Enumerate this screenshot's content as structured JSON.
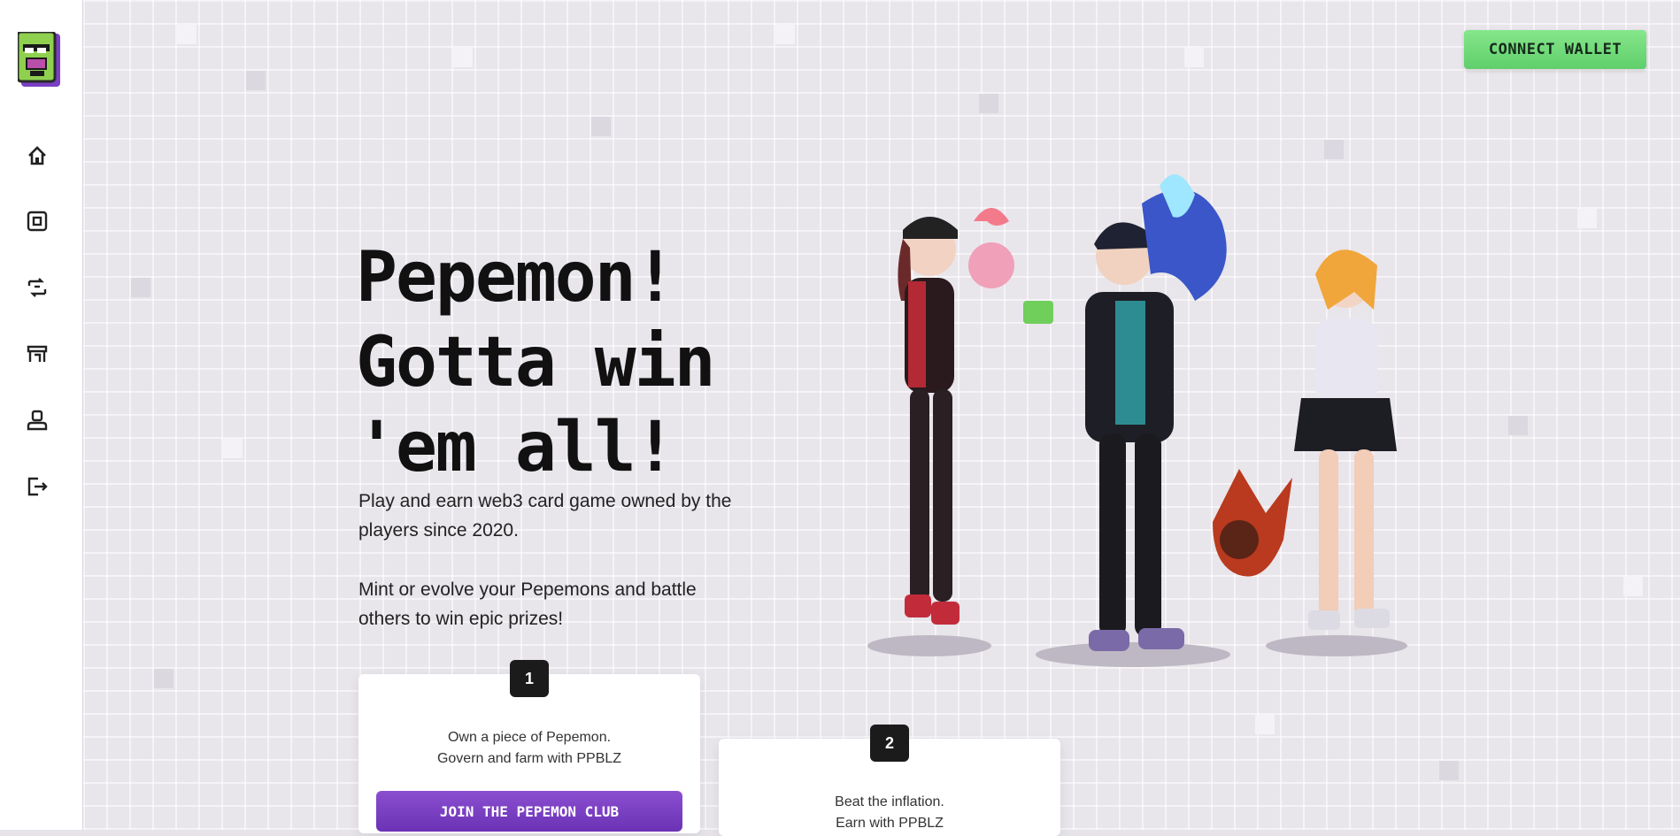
{
  "header": {
    "connect_label": "CONNECT WALLET"
  },
  "sidebar": {
    "logo_icon": "pepemon-logo-icon",
    "items": [
      {
        "name": "home",
        "icon": "home-icon"
      },
      {
        "name": "cards",
        "icon": "card-icon"
      },
      {
        "name": "swap",
        "icon": "swap-icon"
      },
      {
        "name": "store",
        "icon": "store-icon"
      },
      {
        "name": "profile",
        "icon": "user-icon"
      },
      {
        "name": "logout",
        "icon": "logout-icon"
      }
    ]
  },
  "hero": {
    "title_lines": [
      "Pepemon!",
      "Gotta win",
      "'em all!"
    ],
    "paragraph_1": "Play and earn web3 card game owned by the players since 2020.",
    "paragraph_2": "Mint or evolve your Pepemons and battle others to win epic prizes!"
  },
  "cards": [
    {
      "number": "1",
      "line1": "Own a piece of Pepemon.",
      "line2": "Govern and farm with PPBLZ",
      "button": "JOIN THE PEPEMON CLUB"
    },
    {
      "number": "2",
      "line1": "Beat the inflation.",
      "line2": "Earn with PPBLZ"
    }
  ],
  "colors": {
    "accent_green": "#6fdc78",
    "accent_purple": "#7a3fc4",
    "logo_green": "#8fd14f"
  }
}
